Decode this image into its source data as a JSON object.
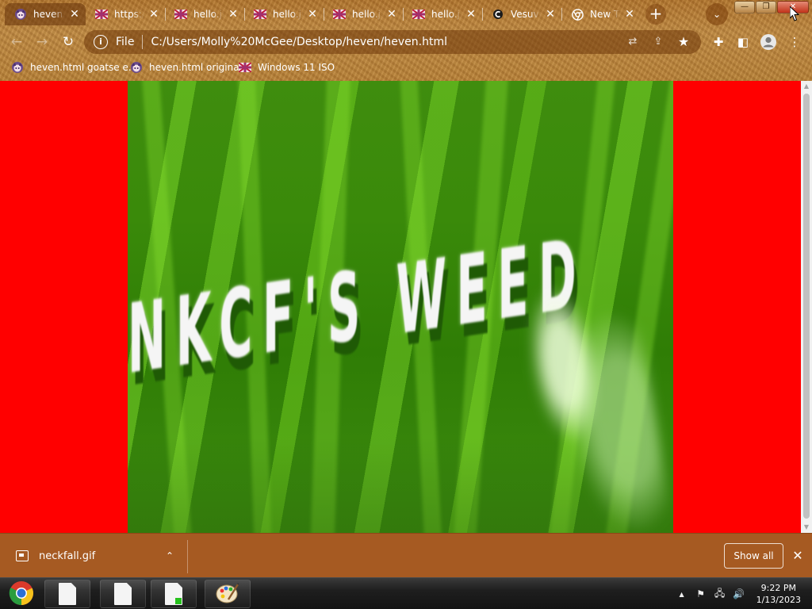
{
  "browser": {
    "tabs": [
      {
        "title": "heven.h",
        "active": true,
        "icon": "anime-avatar-icon"
      },
      {
        "title": "https:/",
        "active": false,
        "icon": "uk-flag-icon"
      },
      {
        "title": "hello.jp",
        "active": false,
        "icon": "uk-flag-icon"
      },
      {
        "title": "hello.jp",
        "active": false,
        "icon": "uk-flag-icon"
      },
      {
        "title": "hello.jp",
        "active": false,
        "icon": "uk-flag-icon"
      },
      {
        "title": "hello.jp",
        "active": false,
        "icon": "uk-flag-icon"
      },
      {
        "title": "Vesuvi",
        "active": false,
        "icon": "vesuvius-icon"
      },
      {
        "title": "New Ta",
        "active": false,
        "icon": "chrome-icon"
      }
    ],
    "new_tab_symbol": "+",
    "tab_search_symbol": "⌄",
    "window_controls": {
      "minimize": "—",
      "maximize": "❐",
      "close": "✕"
    },
    "nav": {
      "back": "←",
      "forward": "→",
      "reload": "↻"
    },
    "address": {
      "info_symbol": "i",
      "scheme_label": "File",
      "url": "C:/Users/Molly%20McGee/Desktop/heven/heven.html"
    },
    "toolbar_symbols": {
      "translate": "⇄",
      "share": "⇪",
      "bookmark_star": "★",
      "extensions": "✚",
      "side_panel": "◧",
      "menu": "⋮"
    },
    "bookmarks": [
      {
        "label": "heven.html goatse e...",
        "icon": "anime-avatar-icon"
      },
      {
        "label": "heven.html original",
        "icon": "anime-avatar-icon"
      },
      {
        "label": "Windows 11 ISO",
        "icon": "uk-flag-icon"
      }
    ]
  },
  "page": {
    "background_color": "#ff0000",
    "gif_caption": "NKCF'S WEED"
  },
  "downloads": {
    "file_name": "neckfall.gif",
    "chevron": "⌃",
    "show_all_label": "Show all",
    "close_symbol": "✕"
  },
  "taskbar": {
    "pinned": [
      "chrome-icon",
      "document-icon",
      "document-icon",
      "document-badge-icon",
      "paint-icon"
    ],
    "tray": {
      "show_hidden": "▲",
      "flag": "⚑",
      "network": "🖧",
      "volume": "🔊"
    },
    "time": "9:22 PM",
    "date": "1/13/2023"
  }
}
